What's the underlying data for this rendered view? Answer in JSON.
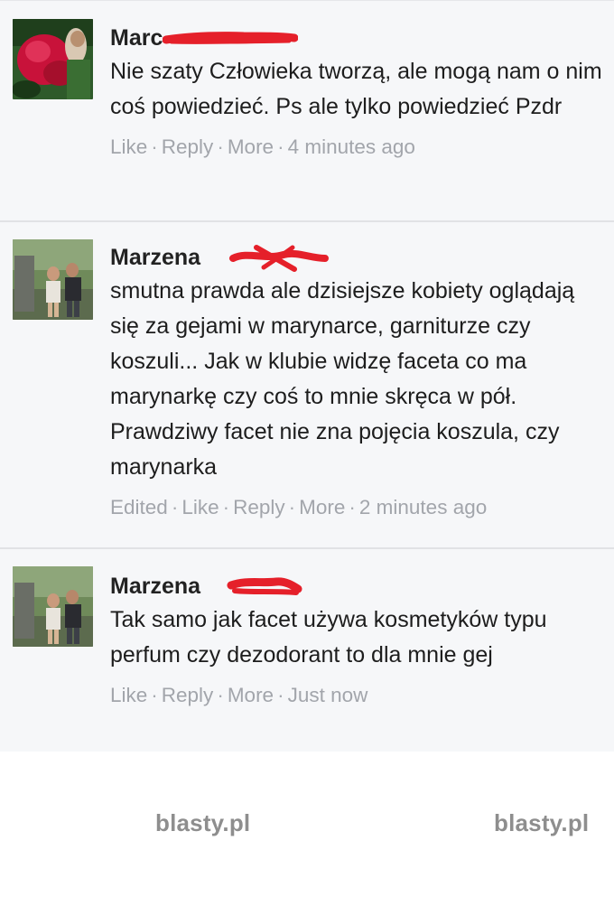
{
  "comments": [
    {
      "author": "Marc",
      "avatar": "profile-photo",
      "text": "Nie szaty Człowieka tworzą, ale mogą nam o nim coś powiedzieć. Ps ale tylko powiedzieć Pzdr",
      "actions": [
        "Like",
        "Reply",
        "More"
      ],
      "time": "4 minutes ago"
    },
    {
      "author": "Marzena",
      "avatar": "profile-photo",
      "text": "smutna prawda ale dzisiejsze kobiety oglądają się za gejami w marynarce, garniturze czy koszuli... Jak w klubie widzę faceta co ma marynarkę czy coś to mnie skręca w pół. Prawdziwy facet nie zna pojęcia koszula, czy marynarka",
      "actions": [
        "Edited",
        "Like",
        "Reply",
        "More"
      ],
      "time": "2 minutes ago"
    },
    {
      "author": "Marzena",
      "avatar": "profile-photo",
      "text": "Tak samo jak facet używa kosmetyków typu perfum czy dezodorant to dla mnie gej",
      "actions": [
        "Like",
        "Reply",
        "More"
      ],
      "time": "Just now"
    }
  ],
  "watermarks": [
    "blasty.pl",
    "blasty.pl"
  ],
  "colors": {
    "redaction": "#e5202a",
    "meta_text": "#a2a5ab",
    "thread_bg": "#f6f7f9"
  }
}
